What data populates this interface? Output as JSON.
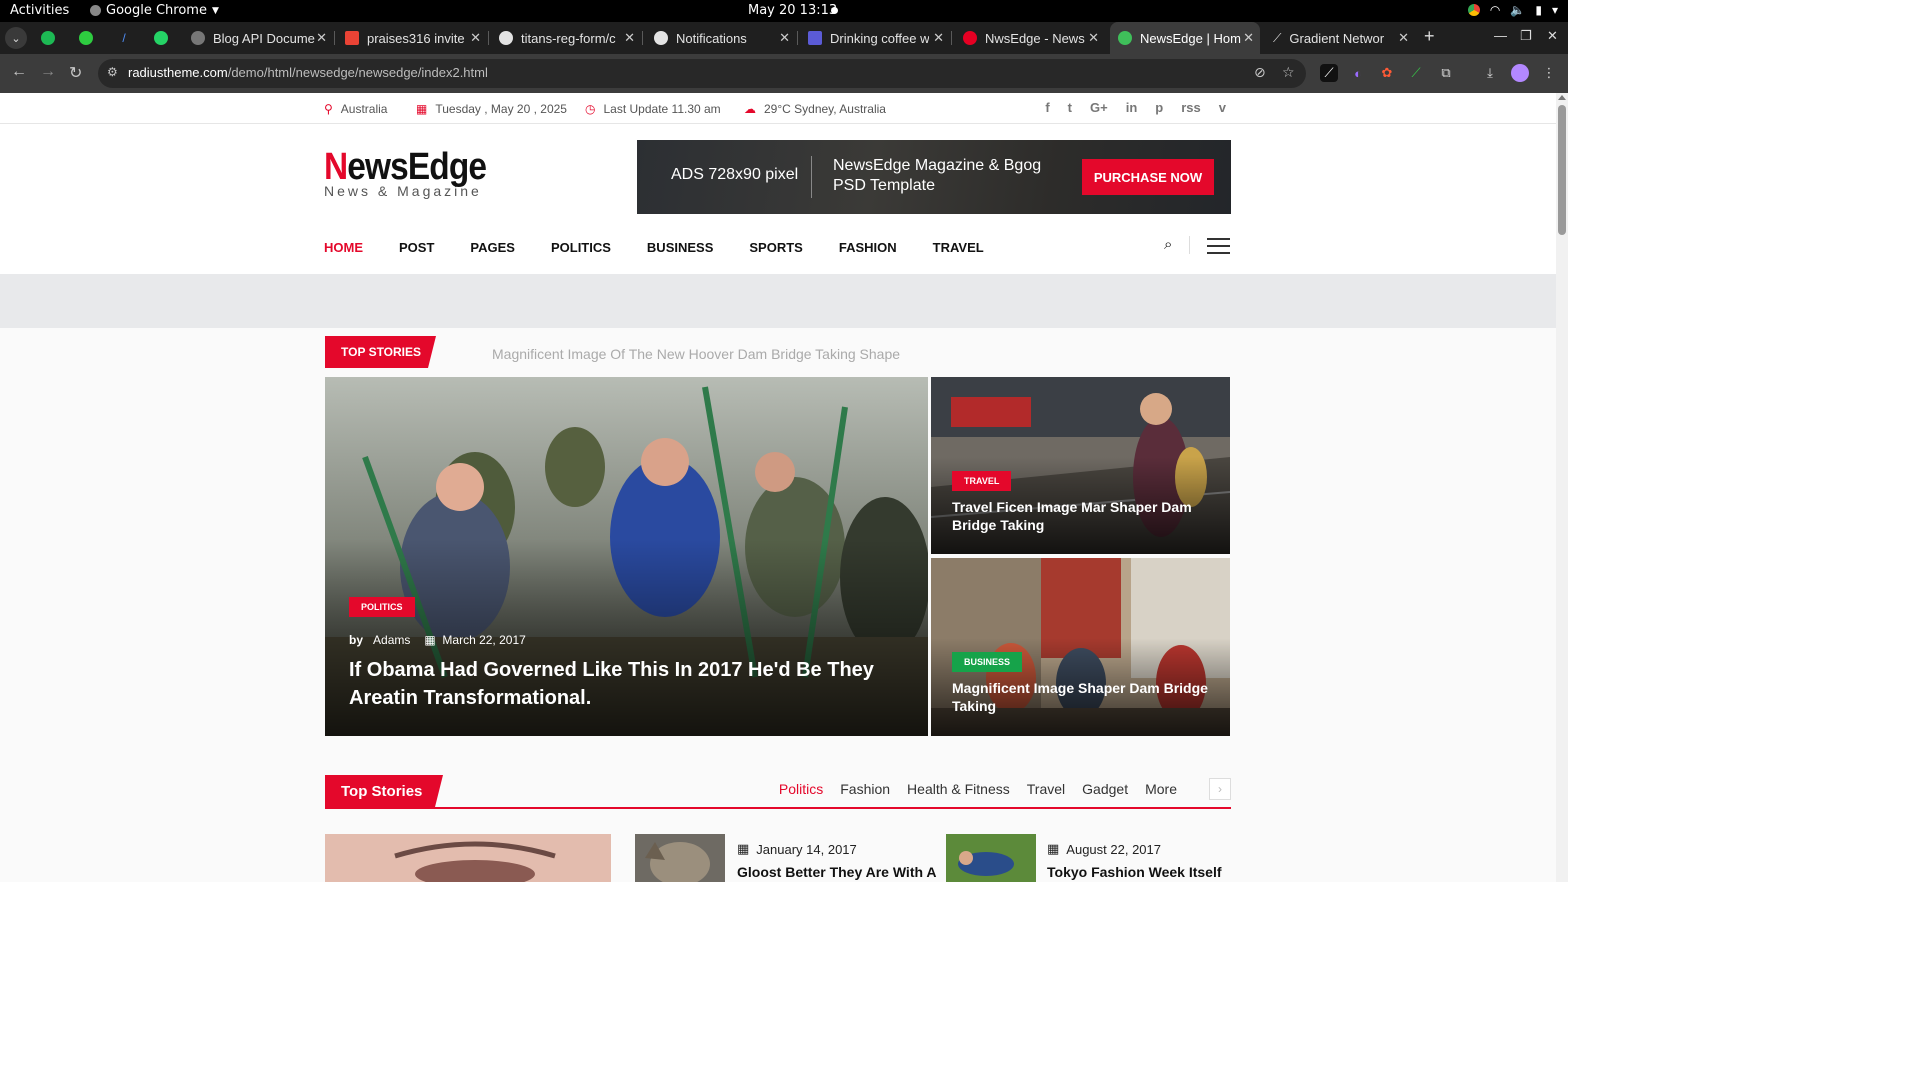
{
  "system": {
    "activities": "Activities",
    "app_name": "Google Chrome",
    "clock": "May 20  13:13"
  },
  "tabs": [
    {
      "title": "Blog API Docume",
      "active": false
    },
    {
      "title": "praises316 invite",
      "active": false
    },
    {
      "title": "titans-reg-form/c",
      "active": false
    },
    {
      "title": "Notifications",
      "active": false
    },
    {
      "title": "Drinking coffee w",
      "active": false
    },
    {
      "title": "NwsEdge - News",
      "active": false
    },
    {
      "title": "NewsEdge | Hom",
      "active": true
    },
    {
      "title": "Gradient Networ",
      "active": false
    }
  ],
  "address": {
    "domain": "radiustheme.com",
    "path": "/demo/html/newsedge/newsedge/index2.html"
  },
  "topbar": {
    "location": "Australia",
    "date": "Tuesday , May 20 , 2025",
    "last_update": "Last Update 11.30 am",
    "weather": "29°C Sydney, Australia",
    "socials": [
      "f",
      "t",
      "G+",
      "in",
      "p",
      "rss",
      "v"
    ]
  },
  "logo": {
    "name_accent": "N",
    "name_rest": "ewsEdge",
    "tagline": "News & Magazine"
  },
  "ad": {
    "size": "ADS 728x90 pixel",
    "text": "NewsEdge Magazine & Bgog PSD Template",
    "button": "PURCHASE NOW"
  },
  "nav": {
    "items": [
      "HOME",
      "POST",
      "PAGES",
      "POLITICS",
      "BUSINESS",
      "SPORTS",
      "FASHION",
      "TRAVEL"
    ],
    "active_index": 0
  },
  "ticker": {
    "label": "TOP STORIES",
    "text": "Magnificent Image Of The New Hoover Dam Bridge Taking Shape"
  },
  "hero_main": {
    "category": "POLITICS",
    "by": "by",
    "author": "Adams",
    "date": "March 22, 2017",
    "title": "If Obama Had Governed Like This In 2017 He'd Be They Areatin Transformational."
  },
  "hero_side": [
    {
      "category": "TRAVEL",
      "title": "Travel Ficen Image Mar Shaper Dam Bridge Taking"
    },
    {
      "category": "BUSINESS",
      "title": "Magnificent Image Shaper Dam Bridge Taking"
    }
  ],
  "section": {
    "title": "Top Stories",
    "tabs": [
      "Politics",
      "Fashion",
      "Health & Fitness",
      "Travel",
      "Gadget",
      "More"
    ],
    "active_tab": 0
  },
  "cards": [
    {
      "date": "January 14, 2017",
      "title": "Gloost Better They Are With A"
    },
    {
      "date": "August 22, 2017",
      "title": "Tokyo Fashion Week Itself"
    }
  ],
  "colors": {
    "accent": "#e4082b",
    "business": "#16a34a"
  }
}
